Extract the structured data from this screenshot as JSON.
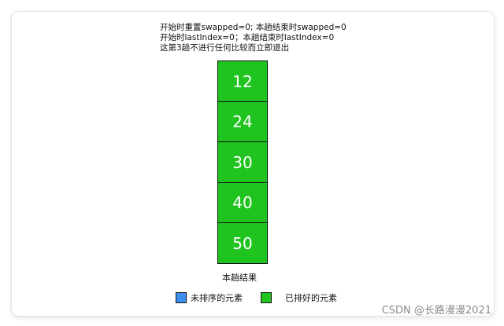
{
  "notes": [
    "开始时重置swapped=0; 本趟结束时swapped=0",
    "开始时lastIndex=0；本趟结束时lastIndex=0",
    "这第3趟不进行任何比较而立即退出"
  ],
  "cells": [
    "12",
    "24",
    "30",
    "40",
    "50"
  ],
  "caption": "本趟结果",
  "legend": {
    "unsorted": {
      "label": "未排序的元素",
      "color": "#3d8ff0"
    },
    "sorted": {
      "label": "已排好的元素",
      "color": "#1fc41f"
    }
  },
  "watermark": "CSDN @长路漫漫2021"
}
